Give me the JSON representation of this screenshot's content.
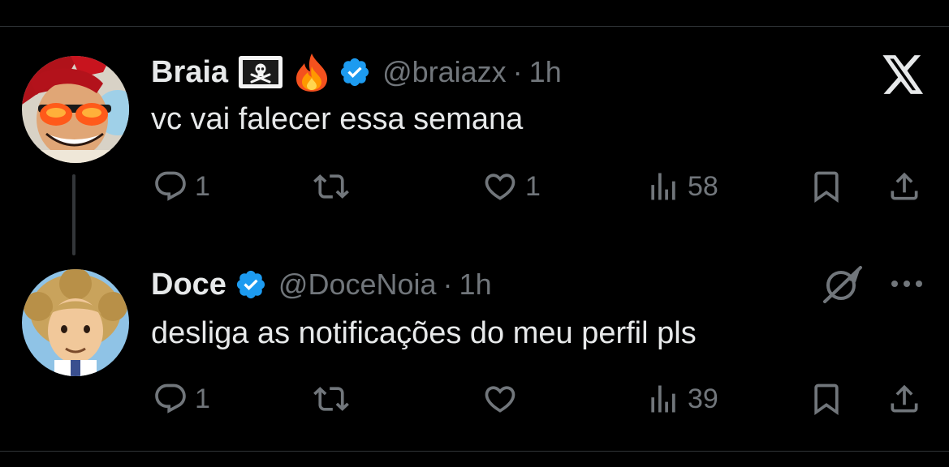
{
  "tweets": [
    {
      "display_name": "Braia",
      "emoji_1": "pirate-flag",
      "emoji_2": "fire",
      "verified": true,
      "handle": "@braiazx",
      "separator": "·",
      "time": "1h",
      "text": "vc vai falecer essa semana",
      "replies": "1",
      "retweets": "",
      "likes": "1",
      "views": "58"
    },
    {
      "display_name": "Doce",
      "verified": true,
      "handle": "@DoceNoia",
      "separator": "·",
      "time": "1h",
      "text": "desliga as notificações do meu perfil pls",
      "replies": "1",
      "retweets": "",
      "likes": "",
      "views": "39"
    }
  ],
  "colors": {
    "background": "#000000",
    "text": "#e7e9ea",
    "secondary": "#71767b",
    "verified": "#1d9bf0",
    "divider": "#2f3336"
  },
  "icons": {
    "logo": "x-logo-icon",
    "grok": "grok-icon",
    "more": "more-icon"
  }
}
